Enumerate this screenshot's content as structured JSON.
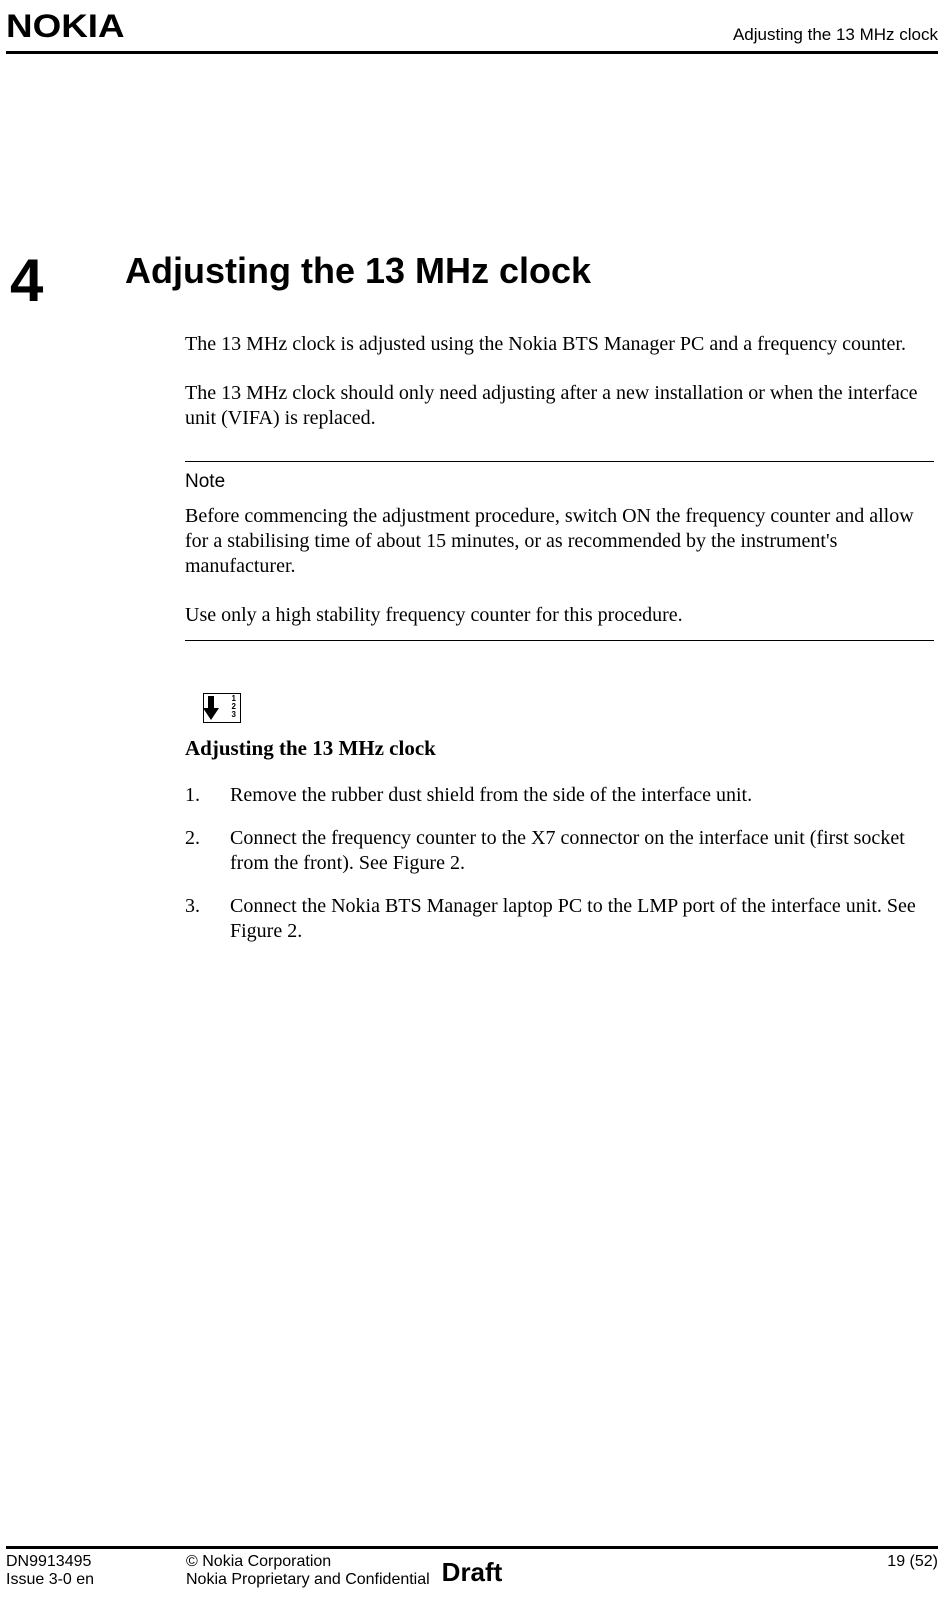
{
  "header": {
    "logo": "NOKIA",
    "running_title": "Adjusting the 13 MHz clock"
  },
  "chapter": {
    "number": "4",
    "title": "Adjusting the 13 MHz clock",
    "intro_paragraphs": [
      "The 13 MHz clock is adjusted using the Nokia BTS Manager PC and a frequency counter.",
      "The 13 MHz clock should only need adjusting after a new installation or when the interface unit (VIFA) is replaced."
    ],
    "note": {
      "heading": "Note",
      "paragraphs": [
        "Before commencing the adjustment procedure, switch ON the frequency counter and allow for a stabilising time of about 15 minutes, or as recommended by the instrument's manufacturer.",
        "Use only a high stability frequency counter for this procedure."
      ]
    },
    "procedure": {
      "icon_digits": [
        "1",
        "2",
        "3"
      ],
      "title": "Adjusting the 13 MHz clock",
      "steps": [
        {
          "n": "1.",
          "text": "Remove the rubber dust shield from the side of the interface unit."
        },
        {
          "n": "2.",
          "text": "Connect the frequency counter to the X7 connector on the interface unit (first socket from the front). See Figure 2."
        },
        {
          "n": "3.",
          "text": "Connect the Nokia BTS Manager laptop PC to the LMP port of the interface unit. See Figure 2."
        }
      ]
    }
  },
  "footer": {
    "doc_number": "DN9913495",
    "issue": "Issue 3-0 en",
    "copyright": "© Nokia Corporation",
    "confidentiality": "Nokia Proprietary and Confidential",
    "status": "Draft",
    "page": "19 (52)"
  }
}
